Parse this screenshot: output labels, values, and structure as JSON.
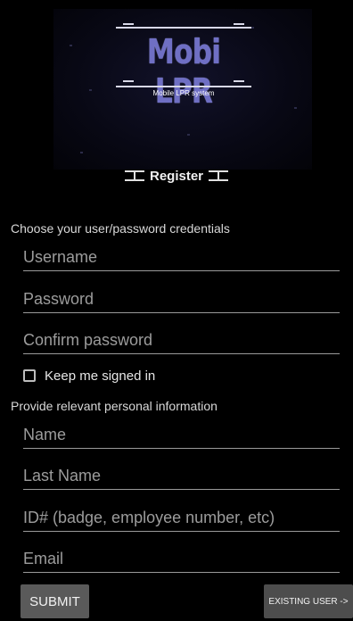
{
  "logo": {
    "title": "Mobi LPR",
    "subtitle": "Mobile LPR system"
  },
  "header": {
    "register_label": "Register"
  },
  "credentials": {
    "section_label": "Choose your user/password credentials",
    "username_placeholder": "Username",
    "password_placeholder": "Password",
    "confirm_placeholder": "Confirm password",
    "keep_signed_in_label": "Keep me signed in",
    "keep_signed_in_checked": false
  },
  "personal": {
    "section_label": "Provide relevant personal information",
    "name_placeholder": "Name",
    "last_name_placeholder": "Last Name",
    "id_placeholder": "ID# (badge, employee number, etc)",
    "email_placeholder": "Email"
  },
  "actions": {
    "submit_label": "SUBMIT",
    "existing_user_label": "EXISTING USER ->"
  },
  "colors": {
    "background": "#000000",
    "logo_text": "#6f6fc4",
    "button_bg": "#5a5a5a"
  }
}
